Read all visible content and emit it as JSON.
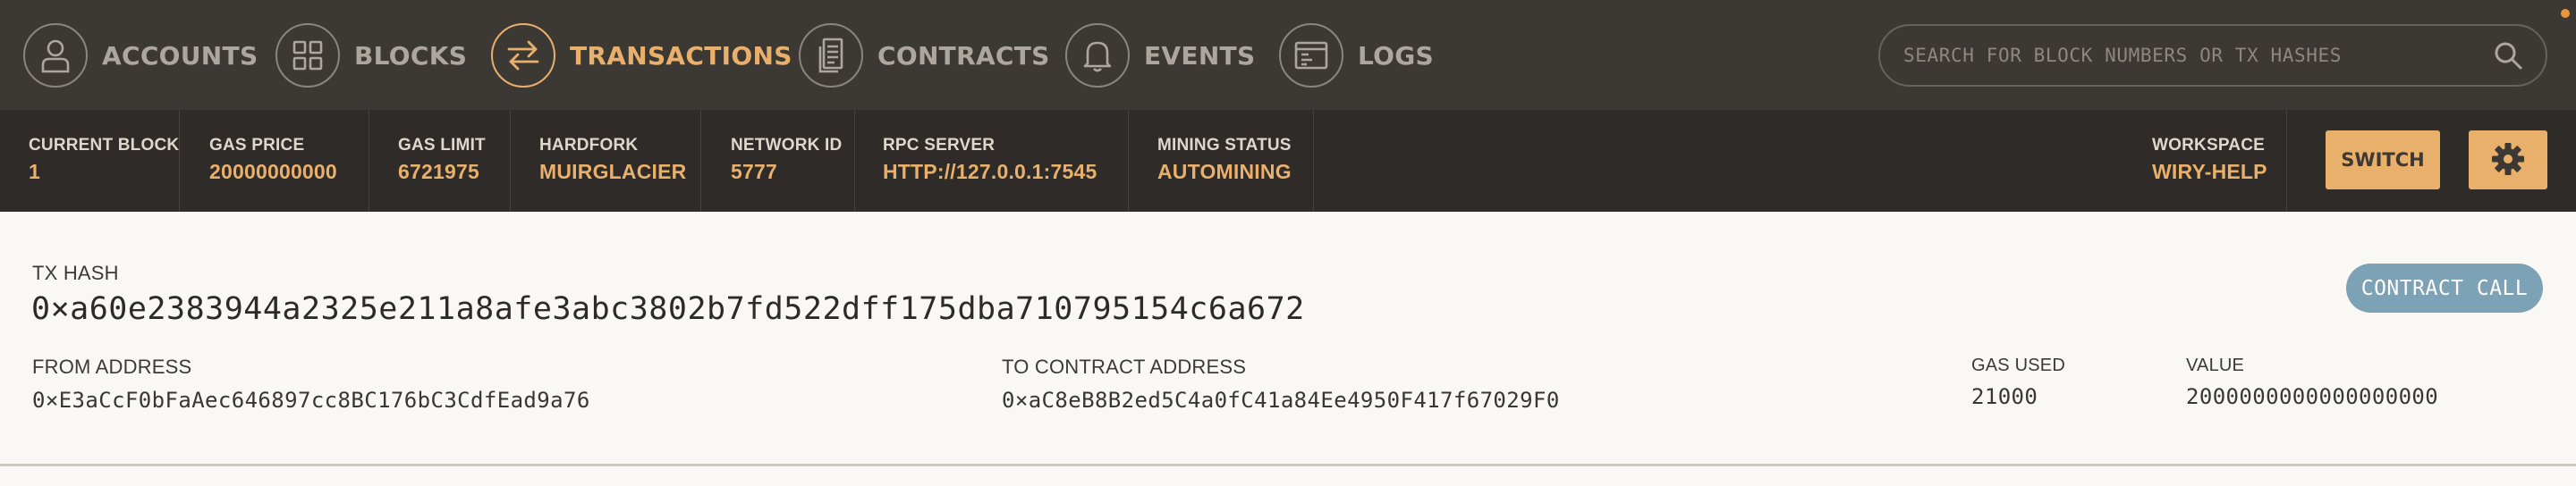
{
  "nav": {
    "items": [
      {
        "label": "ACCOUNTS",
        "icon": "person-icon"
      },
      {
        "label": "BLOCKS",
        "icon": "grid-icon"
      },
      {
        "label": "TRANSACTIONS",
        "icon": "swap-arrows-icon",
        "active": true
      },
      {
        "label": "CONTRACTS",
        "icon": "document-icon"
      },
      {
        "label": "EVENTS",
        "icon": "bell-icon"
      },
      {
        "label": "LOGS",
        "icon": "terminal-window-icon"
      }
    ],
    "search_placeholder": "SEARCH FOR BLOCK NUMBERS OR TX HASHES"
  },
  "status": {
    "current_block": {
      "label": "CURRENT BLOCK",
      "value": "1"
    },
    "gas_price": {
      "label": "GAS PRICE",
      "value": "20000000000"
    },
    "gas_limit": {
      "label": "GAS LIMIT",
      "value": "6721975"
    },
    "hardfork": {
      "label": "HARDFORK",
      "value": "MUIRGLACIER"
    },
    "network_id": {
      "label": "NETWORK ID",
      "value": "5777"
    },
    "rpc_server": {
      "label": "RPC SERVER",
      "value": "HTTP://127.0.0.1:7545"
    },
    "mining_status": {
      "label": "MINING STATUS",
      "value": "AUTOMINING"
    },
    "workspace": {
      "label": "WORKSPACE",
      "value": "WIRY-HELP"
    },
    "switch_label": "SWITCH"
  },
  "transaction": {
    "hash_label": "TX HASH",
    "hash": "0×a60e2383944a2325e211a8afe3abc3802b7fd522dff175dba710795154c6a672",
    "badge": "CONTRACT CALL",
    "from_label": "FROM ADDRESS",
    "from": "0×E3aCcF0bFaAec646897cc8BC176bC3CdfEad9a76",
    "to_label": "TO CONTRACT ADDRESS",
    "to": "0×aC8eB8B2ed5C4a0fC41a84Ee4950F417f67029F0",
    "gas_used_label": "GAS USED",
    "gas_used": "21000",
    "value_label": "VALUE",
    "value": "2000000000000000000"
  },
  "colors": {
    "accent": "#e9b06c",
    "nav_bg": "#3c3935",
    "status_bg": "#2e2b28",
    "badge_bg": "#7ea2b5"
  }
}
